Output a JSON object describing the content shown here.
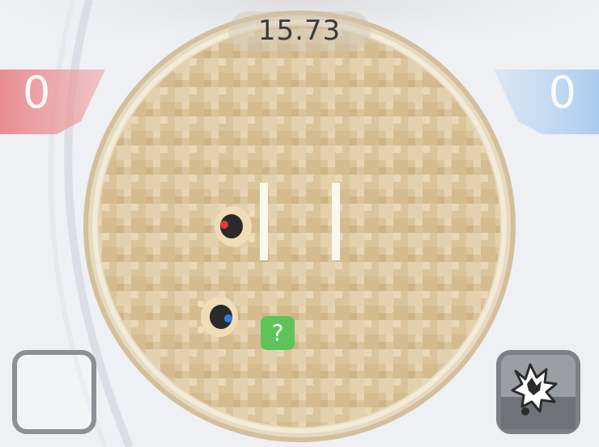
{
  "hud": {
    "timer": "15.73",
    "red_score": "0",
    "blue_score": "0"
  },
  "arena": {
    "mystery_box_label": "?"
  },
  "players": [
    {
      "name": "red-wrestler",
      "team_color": "#e8383c"
    },
    {
      "name": "blue-wrestler",
      "team_color": "#2f7de0"
    }
  ],
  "controls": {
    "left_button_icon": "blank-square-icon",
    "right_button_icon": "explosion-icon"
  },
  "colors": {
    "red_team": "#e8878b",
    "blue_team": "#a9c9ee",
    "sand": "#dcc6a0",
    "powerup": "#5ec45a"
  }
}
